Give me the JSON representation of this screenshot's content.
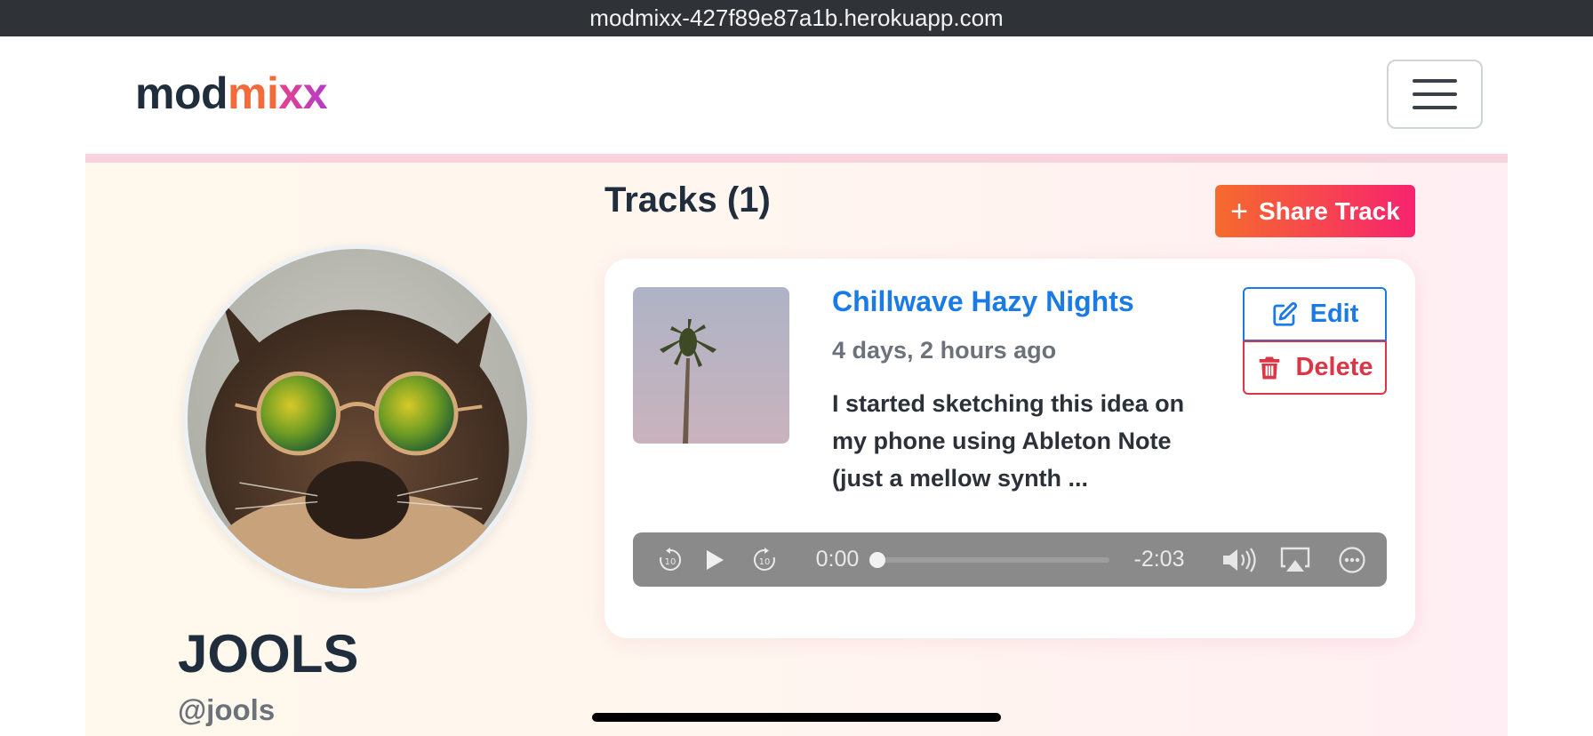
{
  "browser": {
    "url": "modmixx-427f89e87a1b.herokuapp.com"
  },
  "navbar": {
    "logo_part1": "mod",
    "logo_part2": "mi",
    "logo_part3": "xx",
    "menu_icon": "hamburger-menu-icon"
  },
  "profile": {
    "display_name": "JOOLS",
    "username": "@jools",
    "avatar_alt": "cat wearing round mirrored sunglasses"
  },
  "tracks": {
    "heading": "Tracks (1)",
    "share_button_icon": "plus-icon",
    "share_button_label": "Share Track",
    "items": [
      {
        "title": "Chillwave Hazy Nights",
        "posted": "4 days, 2 hours ago",
        "description": "I started sketching this idea on my phone using Ableton Note (just a mellow synth ...",
        "edit_label": "Edit",
        "delete_label": "Delete",
        "player": {
          "current_time": "0:00",
          "remaining_time": "-2:03",
          "progress": 0.0
        }
      }
    ]
  },
  "colors": {
    "link": "#1a7be6",
    "danger": "#dc3545",
    "accent_start": "#f56b2d",
    "accent_end": "#f7236f"
  }
}
